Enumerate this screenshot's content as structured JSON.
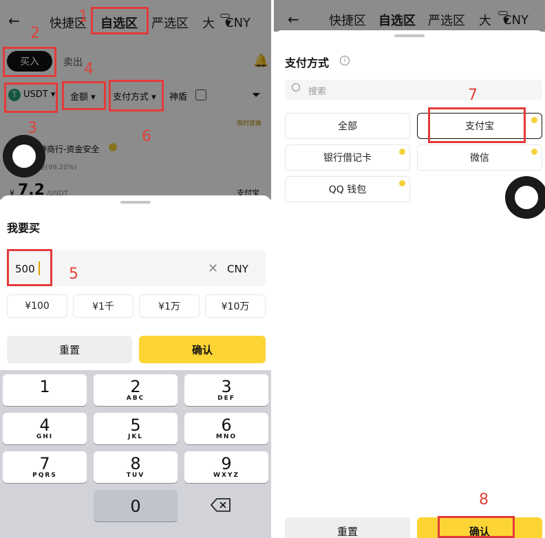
{
  "left": {
    "nav": {
      "back": "←",
      "tab_quick": "快捷区",
      "tab_self": "自选区",
      "tab_strict": "严选区",
      "size_label": "大",
      "currency": "CNY"
    },
    "buy_sell": {
      "buy": "买入",
      "sell": "卖出"
    },
    "filters": {
      "coin": "USDT",
      "amount": "金额",
      "payment": "支付方式",
      "shield": "神盾"
    },
    "ad": {
      "tag": "限时首推",
      "merchant": "神商行-资金安全",
      "stats": "量(99.20%)",
      "price_prefix": "¥",
      "price": "7.2",
      "unit": "/USDT",
      "pay": "支付宝"
    },
    "sheet": {
      "title": "我要买",
      "amount_value": "500",
      "currency": "CNY",
      "quick": [
        "¥100",
        "¥1千",
        "¥1万",
        "¥10万"
      ],
      "reset": "重置",
      "confirm": "确认"
    },
    "keypad": [
      {
        "d": "1",
        "l": ""
      },
      {
        "d": "2",
        "l": "ABC"
      },
      {
        "d": "3",
        "l": "DEF"
      },
      {
        "d": "4",
        "l": "GHI"
      },
      {
        "d": "5",
        "l": "JKL"
      },
      {
        "d": "6",
        "l": "MNO"
      },
      {
        "d": "7",
        "l": "PQRS"
      },
      {
        "d": "8",
        "l": "TUV"
      },
      {
        "d": "9",
        "l": "WXYZ"
      },
      {
        "d": "0",
        "l": ""
      }
    ]
  },
  "right": {
    "nav": {
      "back": "←",
      "tab_quick": "快捷区",
      "tab_self": "自选区",
      "tab_strict": "严选区",
      "size_label": "大",
      "currency": "CNY"
    },
    "sheet": {
      "title": "支付方式",
      "search_placeholder": "搜索",
      "options": [
        "全部",
        "支付宝",
        "银行借记卡",
        "微信",
        "QQ 钱包"
      ],
      "reset": "重置",
      "confirm": "确认"
    }
  },
  "annotations": [
    "1",
    "2",
    "3",
    "4",
    "5",
    "6",
    "7",
    "8"
  ],
  "colors": {
    "accent_yellow": "#fcd535",
    "annotation_red": "#e43a3a",
    "dim_overlay": "rgba(0,0,0,0.45)"
  }
}
